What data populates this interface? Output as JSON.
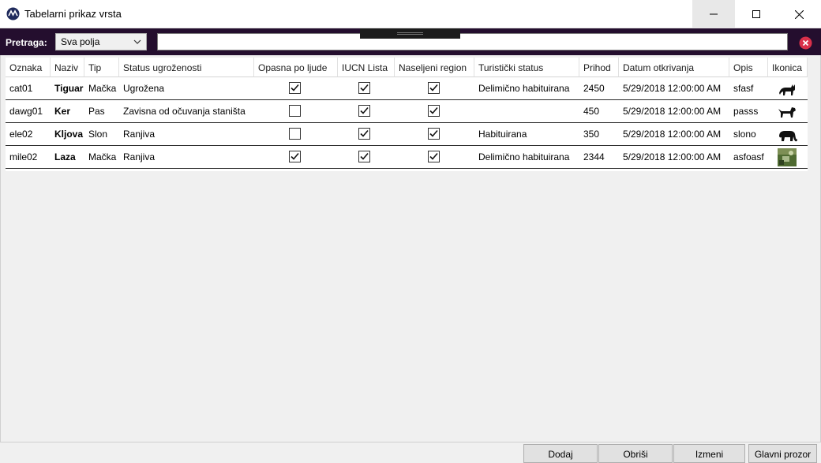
{
  "window": {
    "title": "Tabelarni prikaz vrsta"
  },
  "search": {
    "label": "Pretraga:",
    "field_selected": "Sva polja",
    "query": ""
  },
  "table": {
    "columns": [
      "Oznaka",
      "Naziv",
      "Tip",
      "Status ugroženosti",
      "Opasna po ljude",
      "IUCN Lista",
      "Naseljeni region",
      "Turistički status",
      "Prihod",
      "Datum otkrivanja",
      "Opis",
      "Ikonica"
    ],
    "rows": [
      {
        "oznaka": "cat01",
        "naziv": "Tiguar",
        "tip": "Mačka",
        "status": "Ugrožena",
        "opasna": true,
        "iucn": true,
        "naseljeni": true,
        "turisticki": "Delimično habituirana",
        "prihod": "2450",
        "datum": "5/29/2018 12:00:00 AM",
        "opis": "sfasf",
        "ikonica": "cat-icon"
      },
      {
        "oznaka": "dawg01",
        "naziv": "Ker",
        "tip": "Pas",
        "status": "Zavisna od očuvanja staništa",
        "opasna": false,
        "iucn": true,
        "naseljeni": true,
        "turisticki": "",
        "prihod": "450",
        "datum": "5/29/2018 12:00:00 AM",
        "opis": "passs",
        "ikonica": "dog-icon"
      },
      {
        "oznaka": "ele02",
        "naziv": "Kljova",
        "tip": "Slon",
        "status": "Ranjiva",
        "opasna": false,
        "iucn": true,
        "naseljeni": true,
        "turisticki": "Habituirana",
        "prihod": "350",
        "datum": "5/29/2018 12:00:00 AM",
        "opis": "slono",
        "ikonica": "elephant-icon"
      },
      {
        "oznaka": "mile02",
        "naziv": "Laza",
        "tip": "Mačka",
        "status": "Ranjiva",
        "opasna": true,
        "iucn": true,
        "naseljeni": true,
        "turisticki": "Delimično habituirana",
        "prihod": "2344",
        "datum": "5/29/2018 12:00:00 AM",
        "opis": "asfoasf",
        "ikonica": "photo-icon"
      }
    ]
  },
  "buttons": {
    "add": "Dodaj",
    "delete": "Obriši",
    "edit": "Izmeni",
    "main": "Glavni prozor"
  },
  "colors": {
    "search_bar": "#240e2e",
    "clear_icon": "#d9304a",
    "accent": "#2b2b6b"
  }
}
